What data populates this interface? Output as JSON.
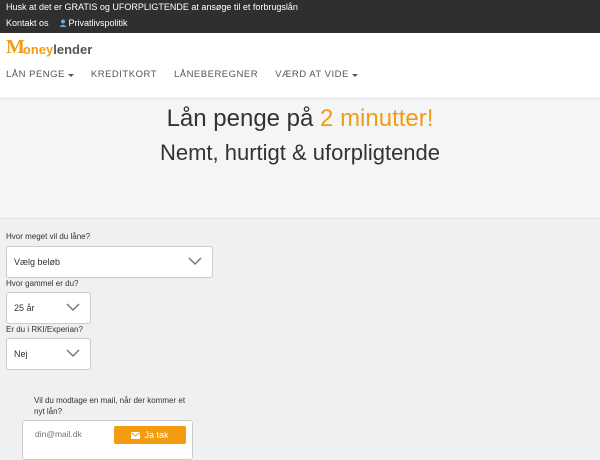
{
  "topbar": {
    "notice": "Husk at det er GRATIS og UFORPLIGTENDE at ansøge til et forbrugslån",
    "contact": "Kontakt os",
    "privacy": "Privatlivspolitik"
  },
  "logo": {
    "first": "M",
    "middle": "oney",
    "bold": "lender"
  },
  "menu": [
    {
      "label": "LÅN PENGE",
      "dropdown": true
    },
    {
      "label": "KREDITKORT",
      "dropdown": false
    },
    {
      "label": "LÅNEBEREGNER",
      "dropdown": false
    },
    {
      "label": "VÆRD AT VIDE",
      "dropdown": true
    }
  ],
  "hero": {
    "title_prefix": "Lån penge på",
    "title_accent": "2 minutter!",
    "subtitle": "Nemt, hurtigt & uforpligtende"
  },
  "form": {
    "amount_label": "Hvor meget vil du låne?",
    "amount_value": "Vælg beløb",
    "age_label": "Hvor gammel er du?",
    "age_value": "25 år",
    "rki_label": "Er du i RKI/Experian?",
    "rki_value": "Nej",
    "mail_label": "Vil du modtage en mail, når der kommer et nyt lån?",
    "mail_placeholder": "din@mail.dk",
    "mail_button": "Ja tak"
  },
  "colors": {
    "accent": "#f39c12",
    "topbar": "#2f2f2f"
  }
}
